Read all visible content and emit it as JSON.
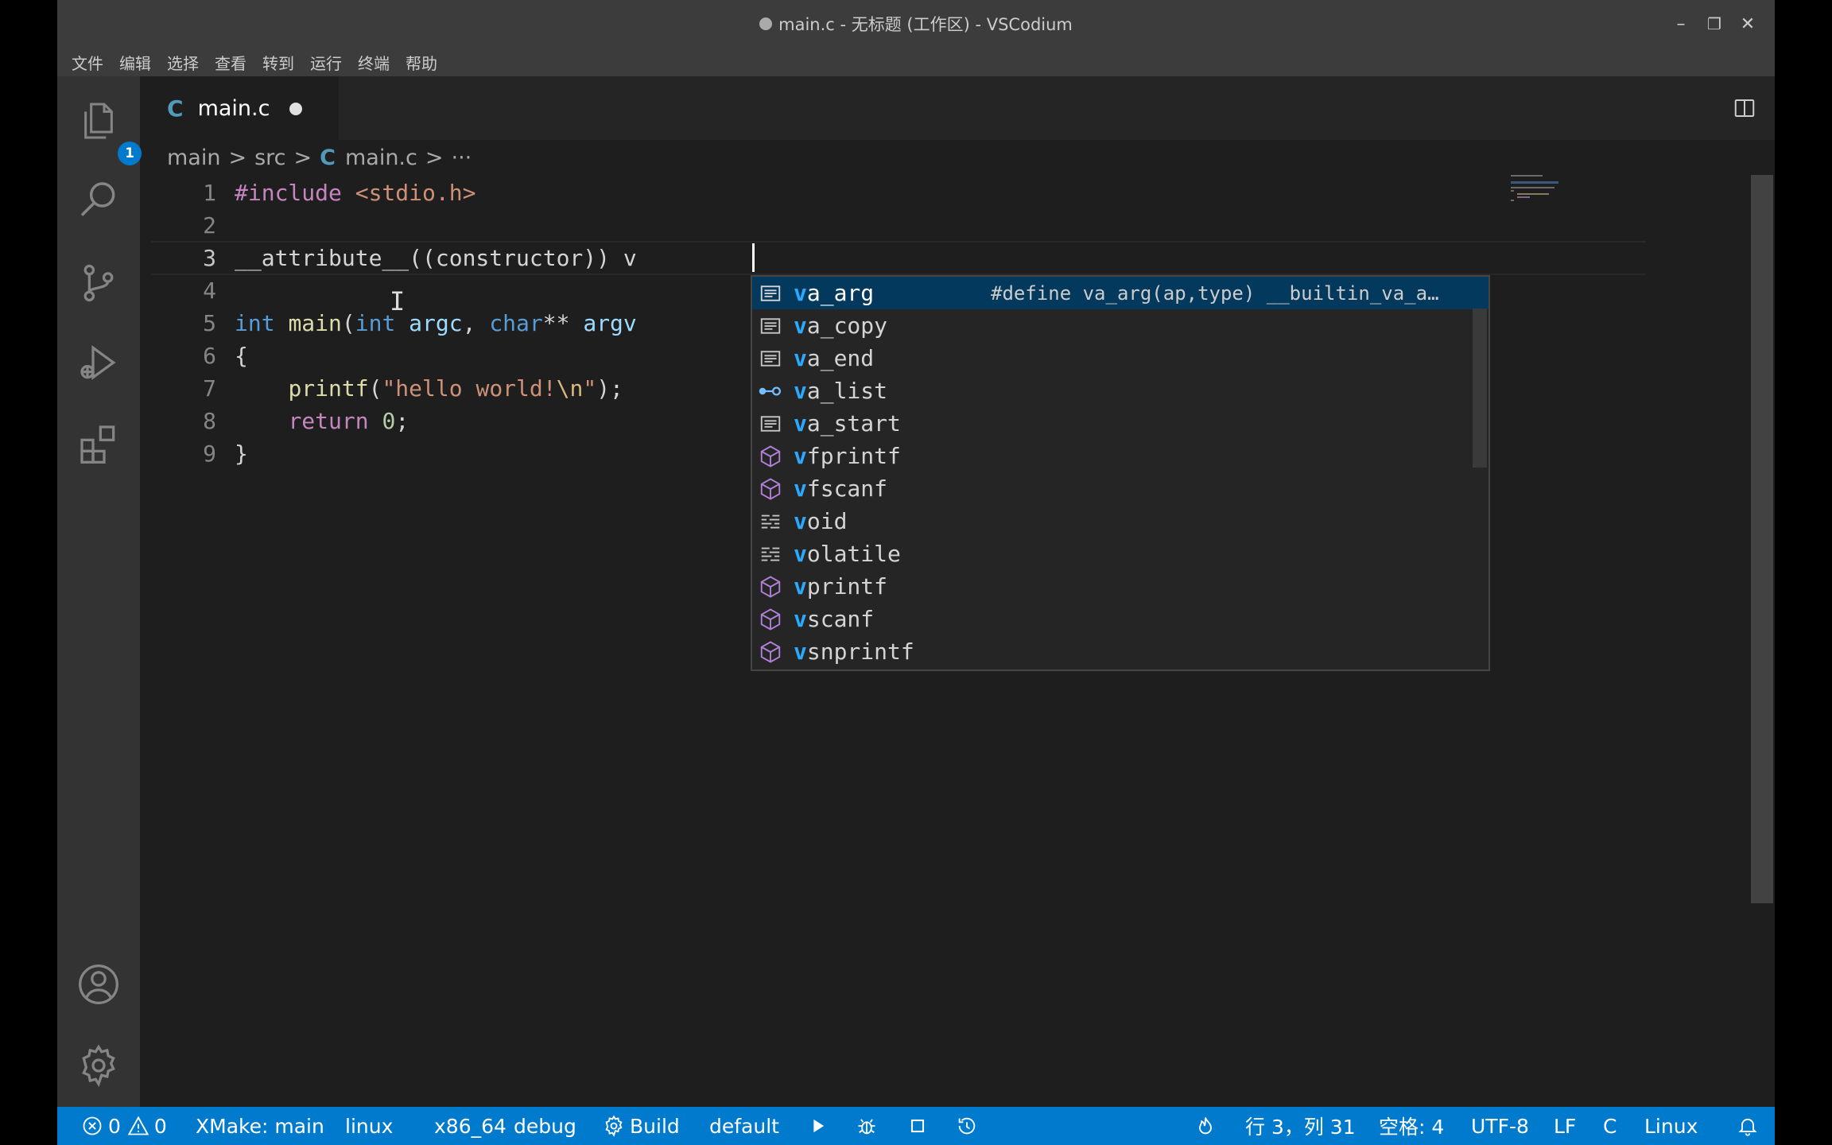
{
  "window": {
    "title": "main.c - 无标题 (工作区) - VSCodium",
    "controls": {
      "minimize": "–",
      "restore": "❐",
      "close": "✕"
    }
  },
  "menu": [
    "文件",
    "编辑",
    "选择",
    "查看",
    "转到",
    "运行",
    "终端",
    "帮助"
  ],
  "activity_bar": {
    "items": [
      {
        "name": "explorer",
        "icon": "files-icon",
        "badge": "1"
      },
      {
        "name": "search",
        "icon": "search-icon"
      },
      {
        "name": "source-control",
        "icon": "source-control-icon"
      },
      {
        "name": "run-debug",
        "icon": "run-debug-icon"
      },
      {
        "name": "extensions",
        "icon": "extensions-icon"
      }
    ],
    "bottom": [
      {
        "name": "accounts",
        "icon": "account-icon"
      },
      {
        "name": "manage",
        "icon": "gear-icon"
      }
    ]
  },
  "tabs": [
    {
      "label": "main.c",
      "icon_text": "C",
      "dirty": true
    }
  ],
  "tab_actions": {
    "split": "◫",
    "more": "···"
  },
  "breadcrumb": {
    "items": [
      "main",
      "src",
      "main.c",
      "···"
    ],
    "separator": ">",
    "file_icon_text": "C"
  },
  "editor": {
    "line_numbers": [
      "1",
      "2",
      "3",
      "4",
      "5",
      "6",
      "7",
      "8",
      "9"
    ],
    "active_line": "3",
    "lines": {
      "l1": {
        "directive": "#include",
        "space": " ",
        "header": "<stdio.h>"
      },
      "l3": {
        "text": "__attribute__((constructor)) v"
      },
      "l5": {
        "t1": "int",
        "t2": " ",
        "t3": "main",
        "t4": "(",
        "t5": "int",
        "t6": " ",
        "t7": "argc",
        "t8": ", ",
        "t9": "char",
        "t10": "** ",
        "t11": "argv"
      },
      "l6": {
        "text": "{"
      },
      "l7": {
        "indent": "    ",
        "fn": "printf",
        "open": "(",
        "s1": "\"hello world!",
        "esc": "\\n",
        "s2": "\"",
        "close": ");"
      },
      "l8": {
        "indent": "    ",
        "kw": "return",
        "space": " ",
        "num": "0",
        "semi": ";"
      },
      "l9": {
        "text": "}"
      }
    },
    "ibeam": "I"
  },
  "suggestions": [
    {
      "match": "v",
      "rest": "a_arg",
      "kind": "snippet-icon",
      "detail": "#define va_arg(ap,type) __builtin_va_a…",
      "selected": true
    },
    {
      "match": "v",
      "rest": "a_copy",
      "kind": "snippet-icon"
    },
    {
      "match": "v",
      "rest": "a_end",
      "kind": "snippet-icon"
    },
    {
      "match": "v",
      "rest": "a_list",
      "kind": "variable-icon"
    },
    {
      "match": "v",
      "rest": "a_start",
      "kind": "snippet-icon"
    },
    {
      "match": "v",
      "rest": "fprintf",
      "kind": "method-icon"
    },
    {
      "match": "v",
      "rest": "fscanf",
      "kind": "method-icon"
    },
    {
      "match": "v",
      "rest": "oid",
      "kind": "keyword-icon"
    },
    {
      "match": "v",
      "rest": "olatile",
      "kind": "keyword-icon"
    },
    {
      "match": "v",
      "rest": "printf",
      "kind": "method-icon"
    },
    {
      "match": "v",
      "rest": "scanf",
      "kind": "method-icon"
    },
    {
      "match": "v",
      "rest": "snprintf",
      "kind": "method-icon"
    }
  ],
  "statusbar": {
    "errors": "0",
    "warnings": "0",
    "xmake": "XMake: main",
    "platform": "linux",
    "arch": "x86_64",
    "mode": "debug",
    "build": "Build",
    "target": "default",
    "position": "行 3，列 31",
    "spaces": "空格: 4",
    "encoding": "UTF-8",
    "eol": "LF",
    "language": "C",
    "os": "Linux"
  },
  "colors": {
    "accent": "#007acc",
    "match": "#2aaaff",
    "selected_row": "#04395e"
  }
}
